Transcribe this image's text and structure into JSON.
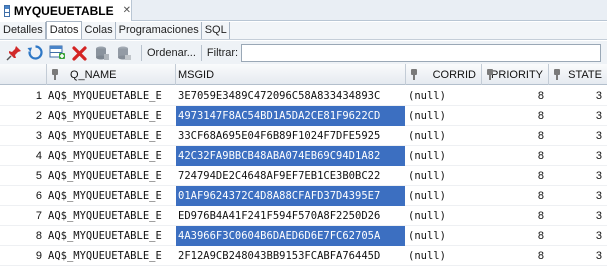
{
  "window": {
    "title": "MYQUEUETABLE",
    "close_symbol": "✕"
  },
  "subtabs": [
    "Detalles",
    "Datos",
    "Colas",
    "Programaciones",
    "SQL"
  ],
  "active_subtab": "Datos",
  "toolbar": {
    "icons": [
      "pin-icon",
      "refresh-icon",
      "insert-row-icon",
      "delete-row-icon",
      "commit-icon",
      "rollback-icon"
    ],
    "sort_label": "Ordenar...",
    "filter_label": "Filtrar:",
    "filter_value": ""
  },
  "columns": [
    "Q_NAME",
    "MSGID",
    "CORRID",
    "PRIORITY",
    "STATE"
  ],
  "rows": [
    {
      "n": "1",
      "q_name": "AQ$_MYQUEUETABLE_E",
      "msgid": "3E7059E3489C472096C58A833434893C",
      "corrid": "(null)",
      "priority": "8",
      "state": "3"
    },
    {
      "n": "2",
      "q_name": "AQ$_MYQUEUETABLE_E",
      "msgid": "4973147F8AC54BD1A5DA2CE81F9622CD",
      "corrid": "(null)",
      "priority": "8",
      "state": "3"
    },
    {
      "n": "3",
      "q_name": "AQ$_MYQUEUETABLE_E",
      "msgid": "33CF68A695E04F6B89F1024F7DFE5925",
      "corrid": "(null)",
      "priority": "8",
      "state": "3"
    },
    {
      "n": "4",
      "q_name": "AQ$_MYQUEUETABLE_E",
      "msgid": "42C32FA9BBCB48ABA074EB69C94D1A82",
      "corrid": "(null)",
      "priority": "8",
      "state": "3"
    },
    {
      "n": "5",
      "q_name": "AQ$_MYQUEUETABLE_E",
      "msgid": "724794DE2C4648AF9EF7EB1CE3B0BC22",
      "corrid": "(null)",
      "priority": "8",
      "state": "3"
    },
    {
      "n": "6",
      "q_name": "AQ$_MYQUEUETABLE_E",
      "msgid": "01AF9624372C4D8A88CFAFD37D4395E7",
      "corrid": "(null)",
      "priority": "8",
      "state": "3"
    },
    {
      "n": "7",
      "q_name": "AQ$_MYQUEUETABLE_E",
      "msgid": "ED976B4A41F241F594F570A8F2250D26",
      "corrid": "(null)",
      "priority": "8",
      "state": "3"
    },
    {
      "n": "8",
      "q_name": "AQ$_MYQUEUETABLE_E",
      "msgid": "4A3966F3C0604B6DAED6D6E7FC62705A",
      "corrid": "(null)",
      "priority": "8",
      "state": "3"
    },
    {
      "n": "9",
      "q_name": "AQ$_MYQUEUETABLE_E",
      "msgid": "2F12A9CB248043BB9153FCABFA76445D",
      "corrid": "(null)",
      "priority": "8",
      "state": "3"
    }
  ],
  "selected_msgid_rows": [
    2,
    4,
    6,
    8
  ],
  "colors": {
    "selection": "#3c6fc1",
    "tab_bar": "#e9eef4"
  }
}
